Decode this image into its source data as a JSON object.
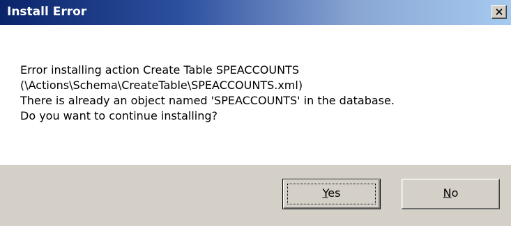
{
  "window": {
    "title": "Install Error"
  },
  "message": {
    "lines": [
      "Error installing action Create Table SPEACCOUNTS",
      "(\\Actions\\Schema\\CreateTable\\SPEACCOUNTS.xml)",
      "There is already an object named 'SPEACCOUNTS' in the database.",
      "Do you want to continue installing?"
    ]
  },
  "buttons": {
    "yes": {
      "mnemonic": "Y",
      "rest": "es",
      "focused": true
    },
    "no": {
      "mnemonic": "N",
      "rest": "o",
      "focused": false
    }
  },
  "icons": {
    "close": "close-icon"
  },
  "colors": {
    "title_bar_start": "#0a246a",
    "title_bar_end": "#a6caf0",
    "panel": "#d4d0c8"
  }
}
